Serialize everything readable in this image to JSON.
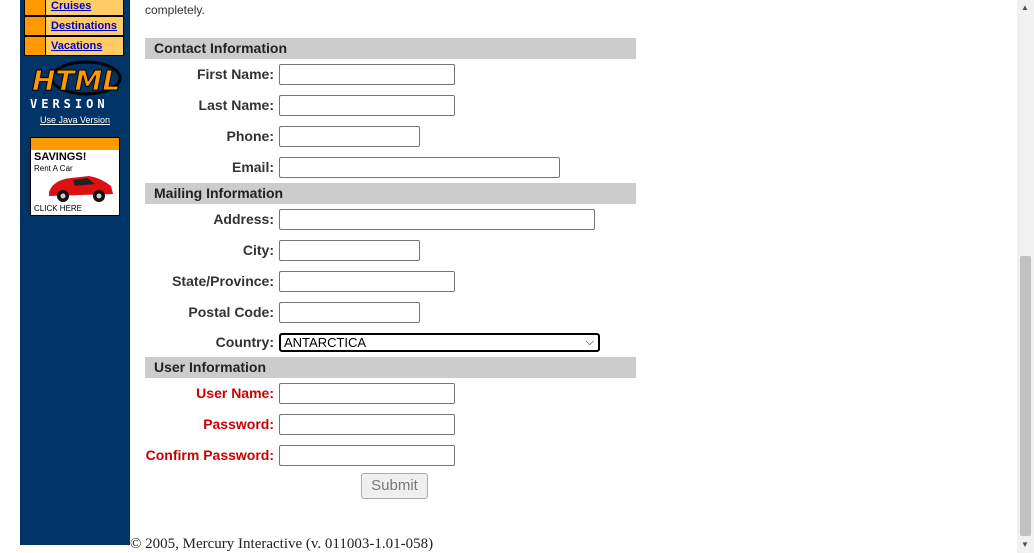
{
  "sidebar": {
    "nav": [
      "Cruises",
      "Destinations",
      "Vacations"
    ],
    "logo_line1": "HTML",
    "logo_line2": "VERSION",
    "java_link": "Use Java Version",
    "ad": {
      "headline": "SAVINGS!",
      "sub": "Rent A Car",
      "cta": "CLICK HERE"
    }
  },
  "intro_text": "completely.",
  "sections": {
    "contact": "Contact Information",
    "mailing": "Mailing Information",
    "user": "User Information"
  },
  "labels": {
    "first_name": "First Name:",
    "last_name": "Last Name:",
    "phone": "Phone:",
    "email": "Email:",
    "address": "Address:",
    "city": "City:",
    "state": "State/Province:",
    "postal": "Postal Code:",
    "country": "Country:",
    "user_name": "User Name:",
    "password": "Password:",
    "confirm_password": "Confirm Password:"
  },
  "country_value": "ANTARCTICA",
  "submit_label": "Submit",
  "footer": "© 2005, Mercury Interactive (v. 011003-1.01-058)",
  "colors": {
    "sidebar": "#003366",
    "section_bar": "#cccccc",
    "required_label": "#cc0000",
    "nav_bg": "#ffcc66"
  }
}
